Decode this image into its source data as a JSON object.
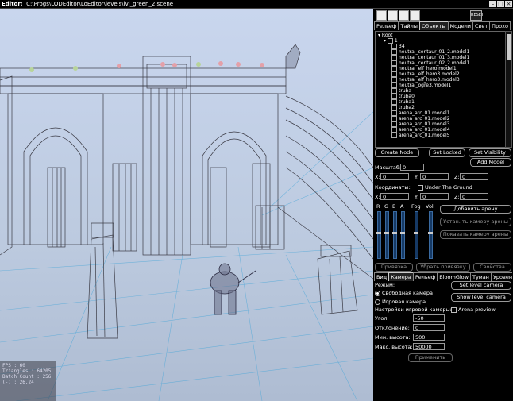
{
  "window": {
    "title": "Editor:",
    "path": "C:\\Progs\\LODEditor\\LoEditor\\levels\\lvl_green_2.scene"
  },
  "toolbar": {
    "reset_label": "RESET"
  },
  "top_tabs": [
    "Рельеф",
    "Тайлы",
    "Объекты",
    "Модели",
    "Свет",
    "Прохо"
  ],
  "tree": {
    "root": "Root",
    "items": [
      "1",
      "34",
      "neutral_centaur_01_2.model1",
      "neutral_centaur_01_3.model1",
      "neutral_centaur_02_2.model1",
      "neutral_elf_hero.model1",
      "neutral_elf_hero3.model2",
      "neutral_elf_hero3.model3",
      "neutral_ogre3.model1",
      "truba",
      "truba0",
      "truba1",
      "truba2",
      "arena_arc_01.model1",
      "arena_arc_01.model2",
      "arena_arc_01.model3",
      "arena_arc_01.model4",
      "arena_arc_01.model5"
    ]
  },
  "object_buttons": {
    "create_node": "Create Node",
    "set_locked": "Set Locked",
    "set_visibility": "Set Visibility",
    "add_model": "Add Model"
  },
  "transform": {
    "scale_label": "Масштаб:",
    "scale_value": "0",
    "x_label": "X:",
    "x_value": "0",
    "y_label": "Y:",
    "y_value": "0",
    "z_label": "Z:",
    "z_value": "0",
    "coords_label": "Координаты:",
    "under_ground_label": "Under The Ground",
    "cx_value": "0",
    "cy_value": "0",
    "cz_value": "0"
  },
  "color_sliders": {
    "labels": [
      "R",
      "G",
      "B",
      "A",
      "Fog",
      "Vol"
    ],
    "levels": [
      0.55,
      0.55,
      0.55,
      0.55,
      0.55,
      0.55
    ]
  },
  "arena_buttons": {
    "add_arena": "Добавить арену",
    "set_camera": "Устан. ть камеру арены",
    "show_camera": "Показать камеру арены"
  },
  "binding_buttons": {
    "bind": "Привязка",
    "unbind": "Убрать привязку",
    "properties": "Свойства"
  },
  "bottom_tabs": [
    "Вид",
    "Камера",
    "Рельеф",
    "BloomGlow",
    "Туман",
    "Уровень"
  ],
  "camera": {
    "mode_label": "Режим:",
    "free_camera": "Свободная камера",
    "game_camera": "Игровая камера",
    "game_camera_settings": "Настройки игровой камеры:",
    "set_level_camera": "Set level camera",
    "show_level_camera": "Show level camera",
    "arena_preview": "Arena preview",
    "angle_label": "Угол:",
    "angle_value": "-50",
    "deviation_label": "Отклонение:",
    "deviation_value": "0",
    "min_height_label": "Мин. высота:",
    "min_height_value": "500",
    "max_height_label": "Макс. высота:",
    "max_height_value": "50000",
    "apply": "Применить"
  },
  "stats": {
    "fps": "FPS : 60",
    "triangles": "Triangles : 64205",
    "batch": "Batch Count : 256",
    "extra": "(-) : 26.24"
  },
  "colors": {
    "sky": "#c9d6ee",
    "wire": "#3a3a44",
    "grid": "#4fa8d8",
    "panel_bg": "#000000",
    "slider": "#163a66"
  }
}
